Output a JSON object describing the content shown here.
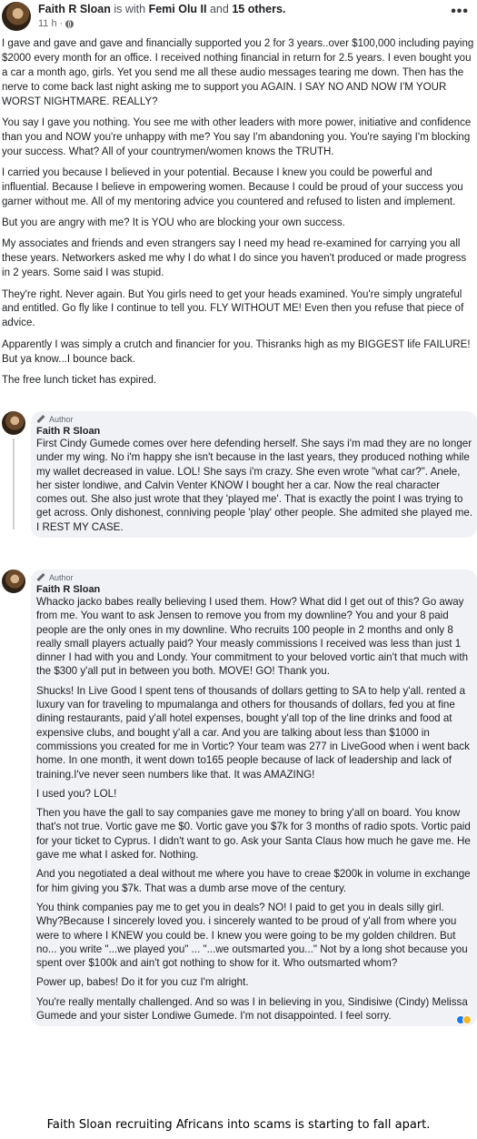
{
  "post": {
    "author": "Faith R Sloan",
    "with_text": "is with",
    "tagged": "Femi Olu II",
    "and_text": "and",
    "others": "15 others.",
    "time": "11 h ·",
    "more": "•••",
    "paragraphs": [
      "I gave and gave and gave and financially supported you 2 for 3 years..over $100,000 including paying $2000 every month for an office. I received nothing financial in return for 2.5 years. I even bought you a car a month ago, girls. Yet you send me all these audio messages tearing me down. Then has the nerve to come back last night  asking me to support you AGAIN. I SAY NO AND NOW I'M YOUR WORST NIGHTMARE. REALLY?",
      "You say I gave you nothing. You see me with other leaders with more power, initiative and confidence than you and NOW you're unhappy with me? You say I'm abandoning you. You're saying I'm blocking your success. What? All of your countrymen/women knows the TRUTH.",
      "I carried you because I believed in your potential. Because I knew you could be powerful and influential. Because I believe in empowering women. Because I could be proud of your success you garner without me.  All of my mentoring advice you countered and refused to listen and implement.",
      "But you are angry with me? It is YOU who are blocking your own success.",
      "My associates and friends and even strangers say I need my head re-examined for carrying you all these years. Networkers asked me why I do what I do since you haven't produced or made progress in 2 years. Some said I was stupid.",
      " They're right. Never again. But You girls  need to get your heads examined. You're simply ungrateful and entitled. Go fly like I continue to tell you. FLY WITHOUT ME! Even then you refuse that piece of advice.",
      "Apparently I was simply a crutch and financier for you. Thisranks high as my BIGGEST life FAILURE! But ya know...I bounce back.",
      "The free lunch ticket has expired."
    ]
  },
  "comments": [
    {
      "badge": "Author",
      "name": "Faith R Sloan",
      "paragraphs": [
        "First Cindy Gumede comes over here defending herself. She says i'm mad they are no longer under my wing. No i'm happy she isn't because in the last years, they produced nothing while my wallet decreased in value. LOL! She says i'm crazy. She even wrote \"what car?\". Anele, her sister londiwe, and Calvin Venter KNOW I bought her a car. Now the real character comes out. She also just wrote that they 'played me'. That is exactly the point I was trying to get across. Only dishonest, conniving people 'play' other people. She admited she played me. I REST MY CASE."
      ]
    },
    {
      "badge": "Author",
      "name": "Faith R Sloan",
      "paragraphs": [
        "Whacko jacko babes really believing I used them. How? What did I get out of this? Go away from me. You want to ask Jensen to remove you from my downline? You and your 8 paid people are the only ones in my downline. Who recruits 100 people in 2 months and only 8 really small players actually paid? Your measly commissions I received was less than just 1 dinner I had with you and Londy. Your commitment to your beloved vortic ain't that much with the $300 y'all put in between you both. MOVE! GO! Thank you.",
        "Shucks! In Live Good I spent tens of thousands of dollars getting to SA to help y'all. rented a luxury van for traveling to mpumalanga and others for thousands of dollars, fed you at fine dining restaurants, paid y'all hotel expenses, bought y'all top of the line drinks and food at expensive clubs, and bought y'all a car. And you are talking about less than $1000 in commissions you created for me in Vortic? Your team was 277 in LiveGood when i went back home. In one month, it went down to165 people because of lack of leadership and lack of training.I've never seen numbers like that. It was AMAZING!",
        "I used you? LOL!",
        "Then you have the gall to say companies gave me money to bring y'all on board. You know that's not true. Vortic gave me $0. Vortic gave you $7k for 3 months of radio spots. Vortic paid for your ticket to Cyprus. I didn't want to go. Ask your Santa Claus how much he gave me. He gave me what I asked for. Nothing.",
        "And you negotiated a deal without me where you have to creae $200k in volume in exchange for him giving you $7k. That was a dumb arse move of the century.",
        "You think companies pay me to get you in deals? NO! I paid to get you in deals silly girl. Why?Because I sincerely loved you. i sincerely wanted to be proud of y'all from where you were to where I KNEW you could be. I knew you were going to be my golden children. But no... you write \"...we played you\" ... \"...we outsmarted you...\" Not by a long shot because you spent over $100k and ain't got nothing to show for it. Who outsmarted whom?",
        "Power up, babes! Do it for you cuz I'm alright.",
        "You're really mentally challenged. And so was I in believing in you, Sindisiwe (Cindy) Melissa Gumede and your sister Londiwe Gumede. I'm not disappointed. I feel sorry."
      ]
    }
  ],
  "caption": "Faith Sloan recruiting Africans into scams is starting to fall apart.",
  "colors": {
    "bubble": "#f0f2f5",
    "text": "#1c1e21",
    "muted": "#65676b",
    "like": "#1877f2",
    "haha": "#f7b928"
  }
}
